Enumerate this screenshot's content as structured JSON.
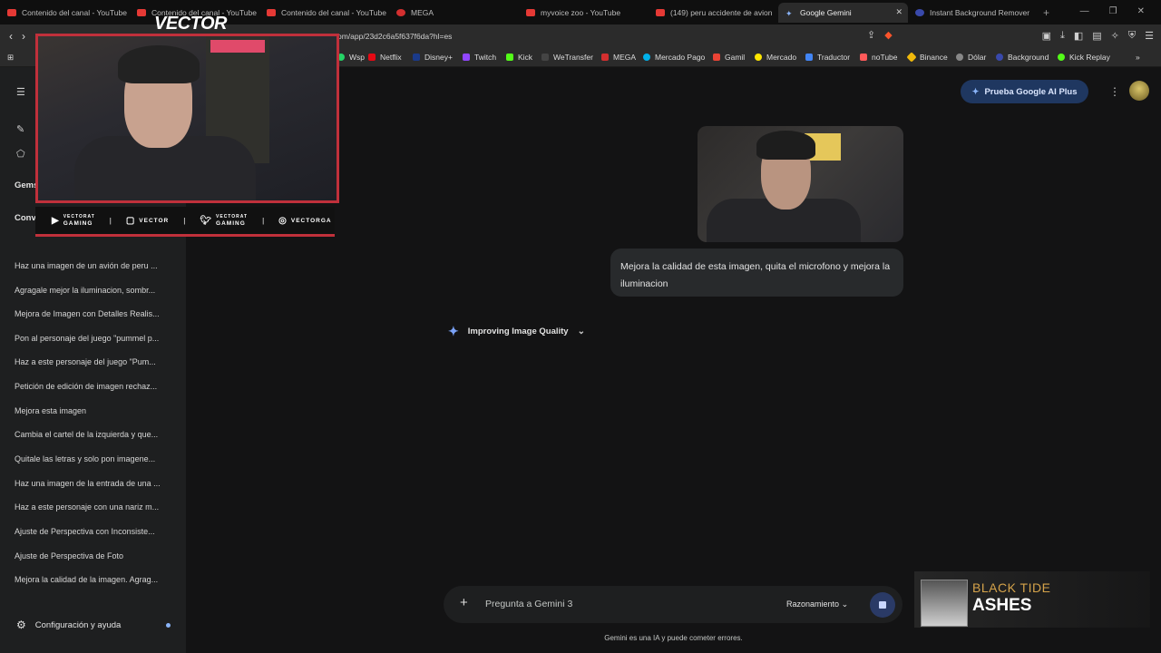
{
  "tabs": [
    {
      "label": "Contenido del canal - YouTube",
      "color": "#e53935"
    },
    {
      "label": "Contenido del canal - YouTube",
      "color": "#e53935"
    },
    {
      "label": "Contenido del canal - YouTube",
      "color": "#e53935"
    },
    {
      "label": "MEGA",
      "color": "#d32f2f"
    },
    {
      "label": "myvoice zoo - YouTube",
      "color": "#e53935"
    },
    {
      "label": "(149) peru accidente de avion",
      "color": "#e53935"
    },
    {
      "label": "Google Gemini",
      "color": "#8ab4f8"
    },
    {
      "label": "Instant Background Remover",
      "color": "#3949ab"
    }
  ],
  "address": {
    "url": "om/app/23d2c6a5f637f6da?hl=es"
  },
  "bookmarks": [
    {
      "label": "Wsp",
      "color": "#25d366"
    },
    {
      "label": "Netflix",
      "color": "#e50914"
    },
    {
      "label": "Disney+",
      "color": "#1a3a8a"
    },
    {
      "label": "Twitch",
      "color": "#9146ff"
    },
    {
      "label": "Kick",
      "color": "#53fc18"
    },
    {
      "label": "WeTransfer",
      "color": "#444444"
    },
    {
      "label": "MEGA",
      "color": "#d32f2f"
    },
    {
      "label": "Mercado Pago",
      "color": "#00b1ea"
    },
    {
      "label": "Gamil",
      "color": "#ea4335"
    },
    {
      "label": "Mercado",
      "color": "#ffe600"
    },
    {
      "label": "Traductor",
      "color": "#4285f4"
    },
    {
      "label": "noTube",
      "color": "#ff5a5a"
    },
    {
      "label": "Binance",
      "color": "#f0b90b"
    },
    {
      "label": "Dólar",
      "color": "#888888"
    },
    {
      "label": "Background",
      "color": "#3949ab"
    },
    {
      "label": "Kick Replay",
      "color": "#53fc18"
    }
  ],
  "sidebar": {
    "gems_label": "Gems",
    "conversations_label": "Conve",
    "conversations": [
      "Haz una imagen de un avión de peru ...",
      "Agragale mejor la iluminacion, sombr...",
      "Mejora de Imagen con Detalles Realis...",
      "Pon al personaje del juego \"pummel p...",
      "Haz a este personaje del juego \"Pum...",
      "Petición de edición de imagen rechaz...",
      "Mejora esta imagen",
      "Cambia el cartel de la izquierda y que...",
      "Quitale las letras y solo pon imagene...",
      "Haz una imagen de la entrada de una ...",
      "Haz a este personaje con una nariz m...",
      "Ajuste de Perspectiva con Inconsiste...",
      "Ajuste de Perspectiva de Foto",
      "Mejora la calidad de la imagen. Agrag..."
    ],
    "settings_label": "Configuración y ayuda"
  },
  "overlay": {
    "brand": "VECTOR",
    "socials": [
      {
        "icon": "youtube-icon",
        "line1": "VECTORAT",
        "line2": "GAMING"
      },
      {
        "icon": "twitch-icon",
        "line1": "VECTOR",
        "line2": ""
      },
      {
        "icon": "twitter-icon",
        "line1": "VECTORAT",
        "line2": "GAMING"
      },
      {
        "icon": "instagram-icon",
        "line1": "VECTORGA",
        "line2": ""
      }
    ]
  },
  "header": {
    "upgrade_label": "Prueba Google AI Plus"
  },
  "chat": {
    "user_message": "Mejora la calidad de esta imagen, quita el microfono y mejora la iluminacion",
    "status": "Improving Image Quality"
  },
  "composer": {
    "placeholder": "Pregunta a Gemini 3",
    "mode": "Razonamiento"
  },
  "disclaimer": "Gemini es una IA y puede cometer errores.",
  "now_playing": {
    "artist": "BLACK TIDE",
    "title": "ASHES"
  }
}
